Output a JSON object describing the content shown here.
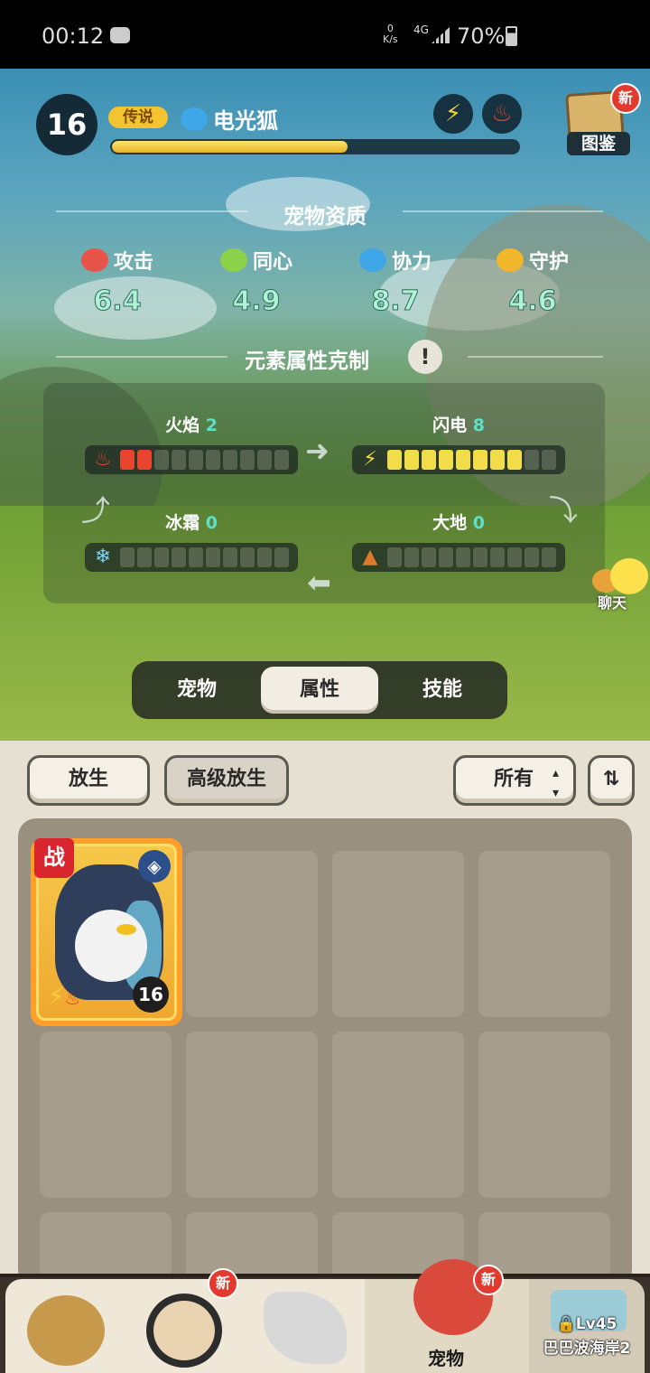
{
  "status_bar": {
    "time": "00:12",
    "net_speed_value": "0",
    "net_speed_unit": "K/s",
    "signal_type": "4G",
    "battery": "70%"
  },
  "pet": {
    "level": "16",
    "rarity": "传说",
    "name": "电光狐",
    "xp_progress": 0.58,
    "element_badges": [
      "lightning-icon",
      "fire-icon"
    ]
  },
  "handbook": {
    "label": "图鉴",
    "new_badge": "新"
  },
  "aptitude": {
    "title": "宠物资质",
    "stats": [
      {
        "name": "攻击",
        "value": "6.4",
        "icon": "attack-fist-icon",
        "color": "#e8544a"
      },
      {
        "name": "同心",
        "value": "4.9",
        "icon": "heart-icon",
        "color": "#8cd14a"
      },
      {
        "name": "协力",
        "value": "8.7",
        "icon": "cooperation-icon",
        "color": "#3fa6e8"
      },
      {
        "name": "守护",
        "value": "4.6",
        "icon": "shield-icon",
        "color": "#f2b62a"
      }
    ]
  },
  "elements": {
    "title": "元素属性克制",
    "info_icon": "info-icon",
    "items": [
      {
        "name": "火焰",
        "value": "2",
        "level": 2,
        "max": 10,
        "icon": "fire-icon",
        "color": "#e8442e"
      },
      {
        "name": "闪电",
        "value": "8",
        "level": 8,
        "max": 10,
        "icon": "lightning-icon",
        "color": "#f2dc4a"
      },
      {
        "name": "冰霜",
        "value": "0",
        "level": 0,
        "max": 10,
        "icon": "snowflake-icon",
        "color": "#7fd0f0"
      },
      {
        "name": "大地",
        "value": "0",
        "level": 0,
        "max": 10,
        "icon": "earth-icon",
        "color": "#e07a2a"
      }
    ]
  },
  "chat": {
    "label": "聊天"
  },
  "tabs": [
    {
      "label": "宠物",
      "active": false
    },
    {
      "label": "属性",
      "active": true
    },
    {
      "label": "技能",
      "active": false
    }
  ],
  "actions": {
    "release": "放生",
    "advanced_release": "高级放生",
    "filter": "所有",
    "sort_icon": "sort-icon"
  },
  "pet_card": {
    "battle_tag": "战",
    "level": "16",
    "element_icons": [
      "lightning-icon",
      "fire-icon"
    ]
  },
  "nav": {
    "items": [
      {
        "label": "",
        "icon": "character-tribe-icon",
        "badge": ""
      },
      {
        "label": "",
        "icon": "character-hero-icon",
        "badge": "新"
      },
      {
        "label": "",
        "icon": "equipment-sword-icon",
        "badge": ""
      },
      {
        "label": "宠物",
        "icon": "pet-dino-icon",
        "badge": "新"
      },
      {
        "label": "",
        "icon": "locked-map-icon",
        "badge": ""
      }
    ],
    "locked_level": "Lv45",
    "locked_area": "巴巴波海岸2"
  }
}
